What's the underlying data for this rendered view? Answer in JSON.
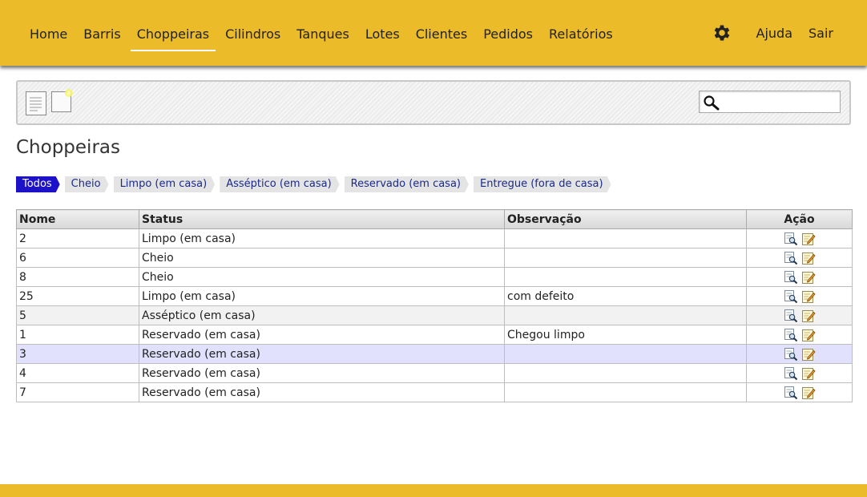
{
  "nav": {
    "items": [
      "Home",
      "Barris",
      "Choppeiras",
      "Cilindros",
      "Tanques",
      "Lotes",
      "Clientes",
      "Pedidos",
      "Relatórios"
    ],
    "active": "Choppeiras",
    "right": {
      "settings_icon": "gear-icon",
      "help": "Ajuda",
      "logout": "Sair"
    }
  },
  "toolbar": {
    "list_icon": "document-list-icon",
    "new_icon": "new-document-icon",
    "search": {
      "icon": "search-icon",
      "value": "",
      "placeholder": ""
    }
  },
  "page": {
    "title": "Choppeiras"
  },
  "filters": {
    "items": [
      "Todos",
      "Cheio",
      "Limpo (em casa)",
      "Asséptico (em casa)",
      "Reservado (em casa)",
      "Entregue (fora de casa)"
    ],
    "active": "Todos"
  },
  "table": {
    "headers": [
      "Nome",
      "Status",
      "Observação",
      "Ação"
    ],
    "rows": [
      {
        "nome": "2",
        "status": "Limpo (em casa)",
        "obs": ""
      },
      {
        "nome": "6",
        "status": "Cheio",
        "obs": ""
      },
      {
        "nome": "8",
        "status": "Cheio",
        "obs": ""
      },
      {
        "nome": "25",
        "status": "Limpo (em casa)",
        "obs": "com defeito"
      },
      {
        "nome": "5",
        "status": "Asséptico (em casa)",
        "obs": ""
      },
      {
        "nome": "1",
        "status": "Reservado (em casa)",
        "obs": "Chegou limpo"
      },
      {
        "nome": "3",
        "status": "Reservado (em casa)",
        "obs": ""
      },
      {
        "nome": "4",
        "status": "Reservado (em casa)",
        "obs": ""
      },
      {
        "nome": "7",
        "status": "Reservado (em casa)",
        "obs": ""
      }
    ],
    "alt_row": 4,
    "highlight_row": 6,
    "action_icons": [
      "view-icon",
      "edit-icon"
    ]
  },
  "colors": {
    "brand": "#ebbb29",
    "active_tab": "#1d12c8",
    "tab_text": "#1a2a8c",
    "row_highlight": "#e1e1fd"
  }
}
